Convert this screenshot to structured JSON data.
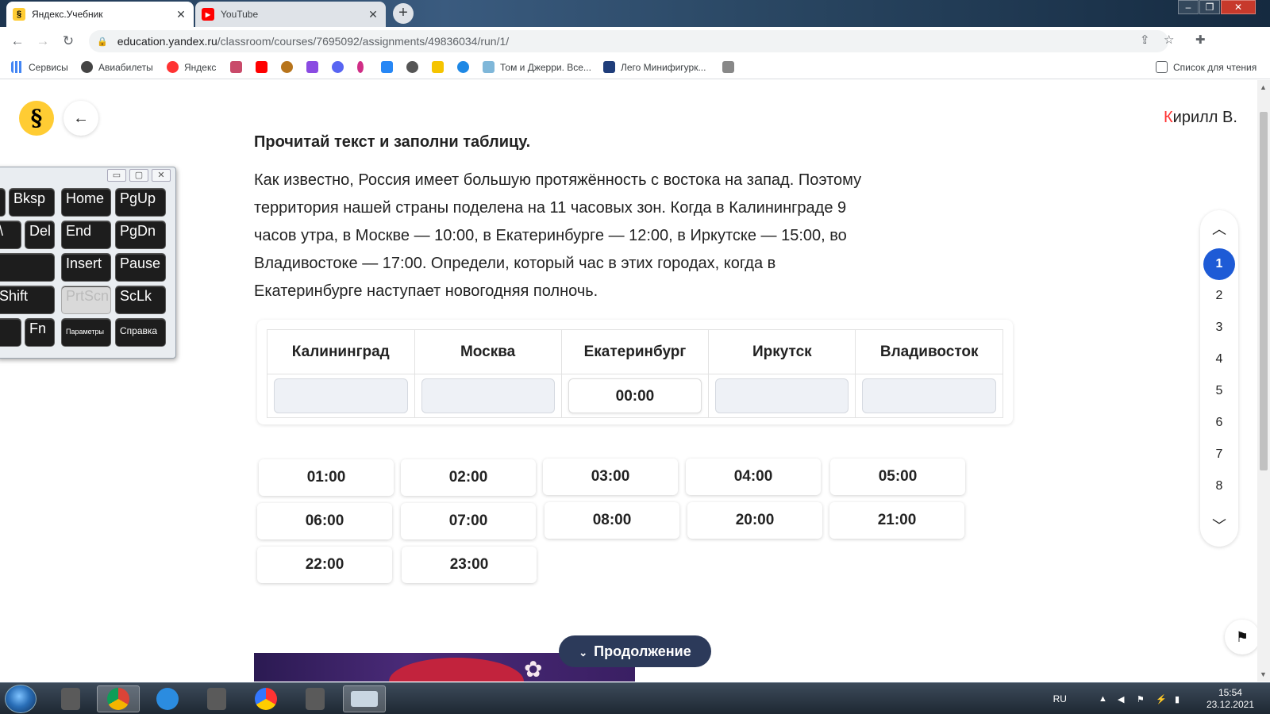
{
  "browser": {
    "tabs": [
      {
        "title": "Яндекс.Учебник",
        "active": true,
        "icon": "yandex-textbook-icon"
      },
      {
        "title": "YouTube",
        "active": false,
        "icon": "youtube-icon"
      }
    ],
    "url_host": "education.yandex.ru",
    "url_path": "/classroom/courses/7695092/assignments/49836034/run/1/",
    "bookmarks": [
      {
        "label": "Сервисы",
        "icon": "apps-grid-icon"
      },
      {
        "label": "Авиабилеты",
        "icon": "plane-icon"
      },
      {
        "label": "Яндекс",
        "icon": "yandex-icon"
      },
      {
        "label": "Том и Джерри. Все...",
        "icon": "tom-jerry-icon"
      },
      {
        "label": "Лего Минифигурк...",
        "icon": "lego-icon"
      }
    ],
    "reading_list": "Список для чтения"
  },
  "header": {
    "logo_glyph": "§",
    "user_first": "К",
    "user_rest": "ирилл В."
  },
  "task": {
    "title": "Прочитай текст и заполни таблицу.",
    "text": "Как известно, Россия имеет большую протяжённость с востока на запад. Поэтому территория нашей страны поделена на 11 часовых зон. Когда в Калининграде 9 часов утра, в Москве — 10:00, в Екатеринбурге — 12:00, в Иркутске — 15:00, во Владивостоке — 17:00. Определи, который час в этих городах, когда в Екатеринбурге наступает новогодняя полночь.",
    "columns": [
      "Калининград",
      "Москва",
      "Екатеринбург",
      "Иркутск",
      "Владивосток"
    ],
    "filled": {
      "Екатеринбург": "00:00"
    },
    "options": [
      "01:00",
      "02:00",
      "03:00",
      "04:00",
      "05:00",
      "06:00",
      "07:00",
      "08:00",
      "20:00",
      "21:00",
      "22:00",
      "23:00"
    ]
  },
  "continue_label": "Продолжение",
  "question_nav": {
    "numbers": [
      "1",
      "2",
      "3",
      "4",
      "5",
      "6",
      "7",
      "8"
    ],
    "active": "1"
  },
  "keyboard": {
    "keys": [
      "Bksp",
      "Home",
      "PgUp",
      "\\",
      "Del",
      "End",
      "PgDn",
      "Insert",
      "Pause",
      "Shift",
      "PrtScn",
      "ScLk",
      "Fn",
      "Параметры",
      "Справка"
    ]
  },
  "taskbar": {
    "lang": "RU",
    "time": "15:54",
    "date": "23.12.2021"
  }
}
